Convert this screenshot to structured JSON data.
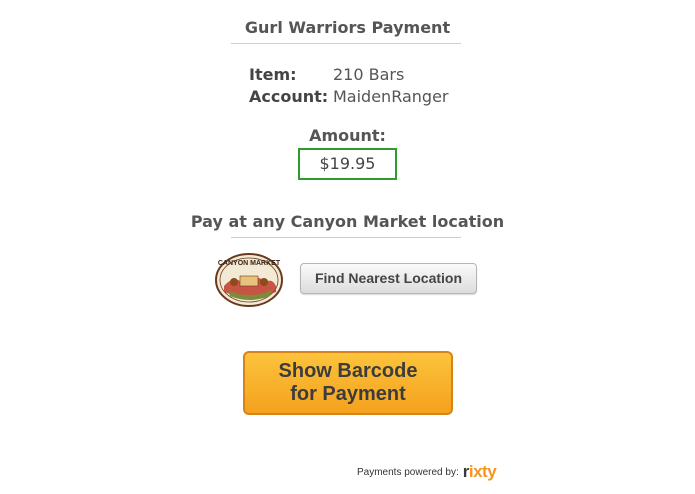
{
  "header": {
    "title": "Gurl Warriors Payment"
  },
  "details": {
    "item_label": "Item:",
    "item_value": "210 Bars",
    "account_label": "Account:",
    "account_value": "MaidenRanger"
  },
  "amount": {
    "label": "Amount:",
    "value": "$19.95"
  },
  "location": {
    "title": "Pay at any Canyon Market location",
    "logo_text": "CANYON MARKET",
    "find_button": "Find Nearest Location"
  },
  "barcode_button": {
    "line1": "Show Barcode",
    "line2": "for Payment"
  },
  "footer": {
    "powered_by": "Payments powered by:",
    "brand": "rixty"
  },
  "colors": {
    "accent_orange": "#f5a11e",
    "amount_border": "#2d9c2d",
    "brand_orange": "#f7941d"
  },
  "icons": {
    "logo": "canyon-market-logo",
    "brand": "rixty-logo"
  }
}
